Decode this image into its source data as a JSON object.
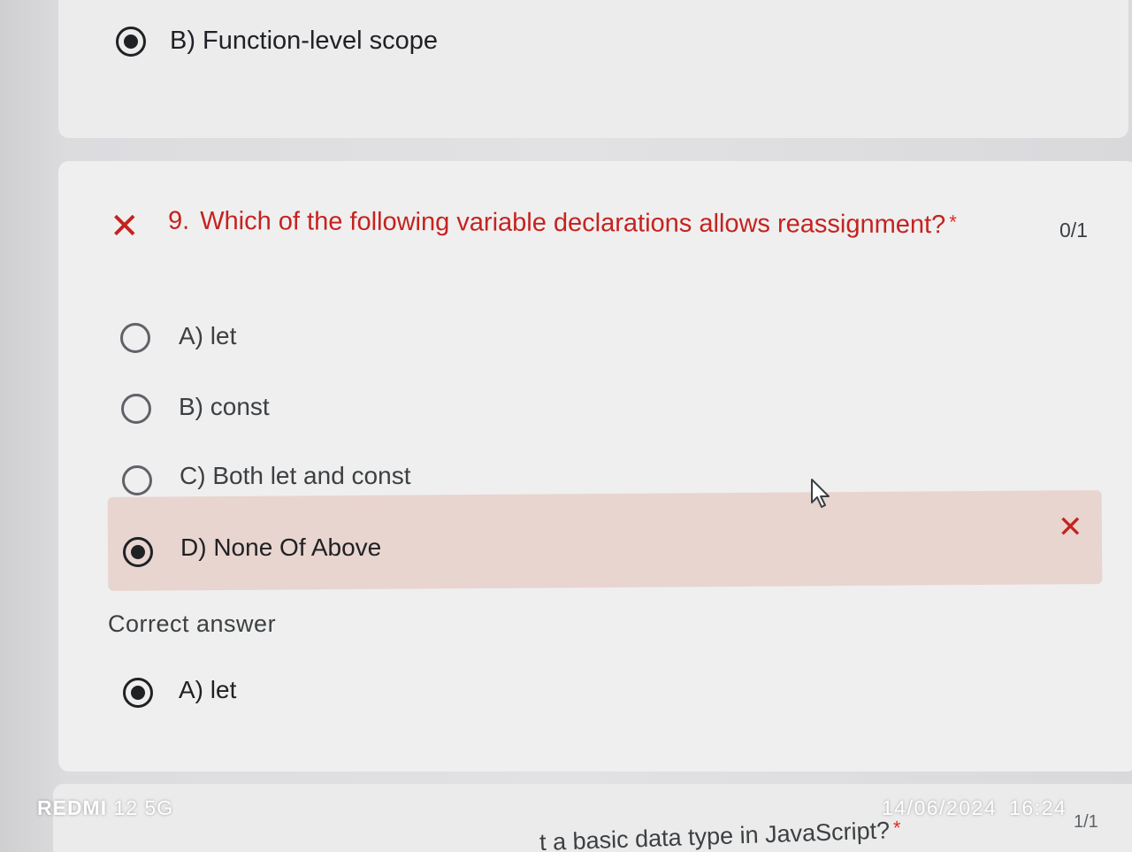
{
  "previous_question": {
    "selected_option_label": "B) Function-level scope"
  },
  "question": {
    "status_icon": "close-icon",
    "number": "9.",
    "text": "Which of the following variable declarations allows reassignment?",
    "required_marker": "*",
    "score": "0/1",
    "options": [
      {
        "label": "A) let",
        "selected": false
      },
      {
        "label": "B) const",
        "selected": false
      },
      {
        "label": "C) Both let and const",
        "selected": false
      },
      {
        "label": "D) None Of Above",
        "selected": true,
        "marked_wrong": true
      }
    ],
    "wrong_marker_icon": "close-icon",
    "correct_answer_heading": "Correct answer",
    "correct_answer_label": "A) let"
  },
  "next_question": {
    "partial_text": "t a basic data type in JavaScript?",
    "required_marker": "*",
    "score": "1/1"
  },
  "photo_watermark": {
    "brand": "REDMI",
    "model": "12 5G",
    "date": "14/06/2024",
    "time": "16:24"
  },
  "colors": {
    "error_red": "#c5221f",
    "wrong_answer_bg": "#e8d5cf",
    "card_bg": "#efefef"
  }
}
